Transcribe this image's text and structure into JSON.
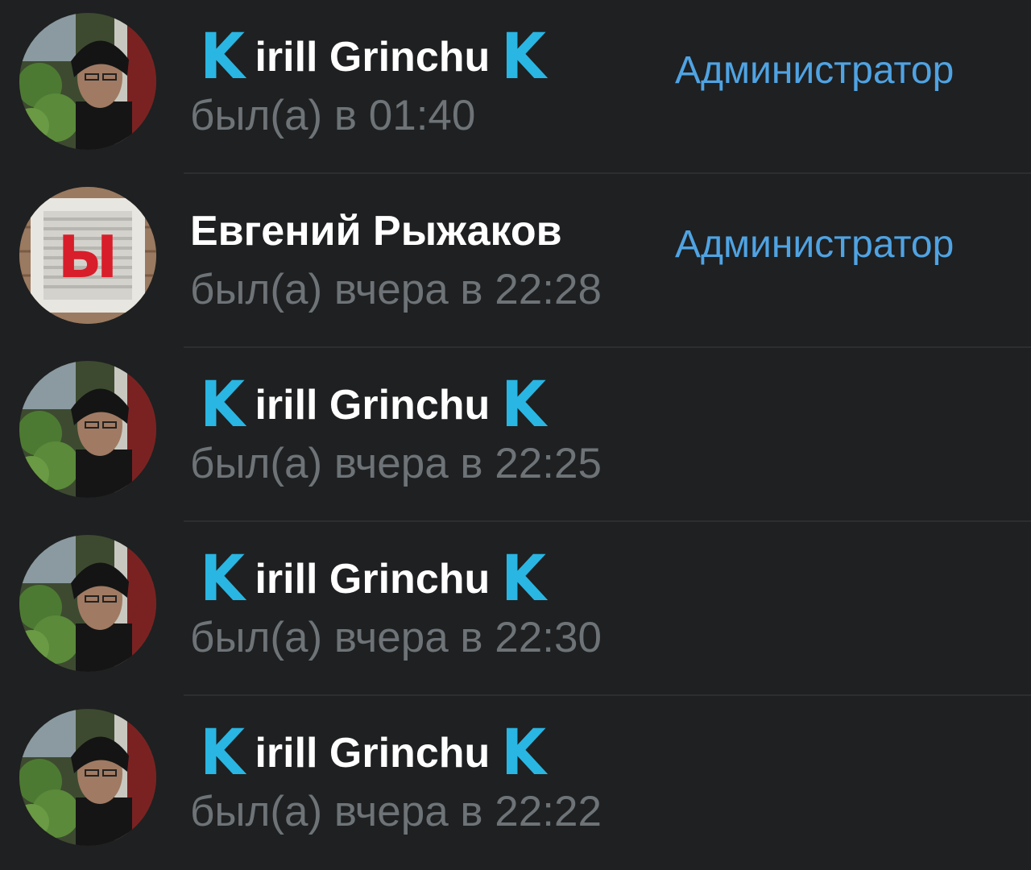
{
  "members": [
    {
      "name_left_glyph": "K",
      "name_middle": "irill Grinchu",
      "name_right_glyph": "K",
      "status": "был(а) в 01:40",
      "role": "Администратор",
      "avatar_icon": "portrait-photo"
    },
    {
      "name": "Евгений Рыжаков",
      "status": "был(а) вчера в 22:28",
      "role": "Администратор",
      "avatar_icon": "sign-photo",
      "avatar_letter": "Ы"
    },
    {
      "name_left_glyph": "K",
      "name_middle": "irill Grinchu",
      "name_right_glyph": "K",
      "status": "был(а) вчера в 22:25",
      "avatar_icon": "portrait-photo"
    },
    {
      "name_left_glyph": "K",
      "name_middle": "irill Grinchu",
      "name_right_glyph": "K",
      "status": "был(а) вчера в 22:30",
      "avatar_icon": "portrait-photo"
    },
    {
      "name_left_glyph": "K",
      "name_middle": "irill Grinchu",
      "name_right_glyph": "K",
      "status": "был(а) вчера в 22:22",
      "avatar_icon": "portrait-photo"
    }
  ],
  "colors": {
    "background": "#1f2021",
    "name": "#ffffff",
    "status": "#6d7377",
    "role": "#4fa3e3",
    "accent_k": "#29b6e3",
    "divider": "#2c2e30"
  }
}
